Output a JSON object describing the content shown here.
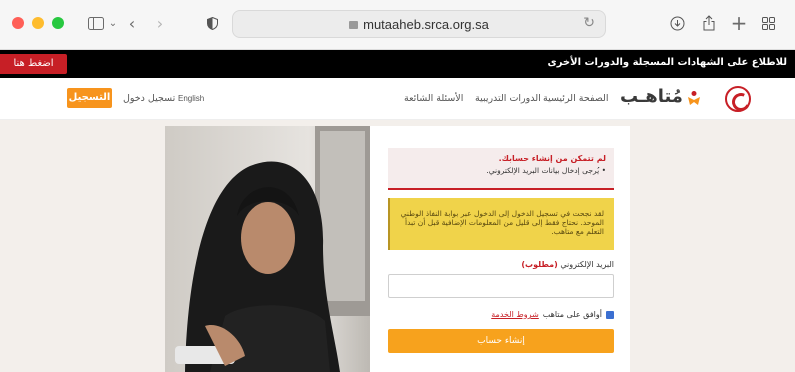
{
  "browser": {
    "url": "mutaaheb.srca.org.sa",
    "colors": {
      "close": "#ff5f57",
      "minimize": "#febc2e",
      "maximize": "#28c840"
    },
    "icons": [
      "sidebar-icon",
      "chevron-down-icon",
      "back-icon",
      "forward-icon",
      "shield-icon",
      "lock-icon",
      "reload-icon",
      "download-icon",
      "share-icon",
      "new-tab-icon",
      "tab-overview-icon"
    ]
  },
  "banner": {
    "button_label": "اضغط هنا",
    "text": "للاطلاع على الشهادات المسجلة والدورات الأخرى"
  },
  "nav": {
    "register_label": "التسجيل",
    "login_label": "تسجيل دخول",
    "language_label": "English",
    "links": [
      "الأسئلة الشائعة",
      "الدورات التدريبية",
      "الصفحة الرئيسية"
    ],
    "logo_text": "مُتاهـب"
  },
  "form": {
    "error_title": "لم تتمكن من إنشاء حسابك.",
    "error_item": "يُرجى إدخال بيانات البريد الإلكتروني.",
    "info_text": "لقد نجحت في تسجيل الدخول إلى الدخول عبر بوابة النفاذ الوطني الموحد. نحتاج فقط إلى قليل من المعلومات الإضافية قبل أن تبدأ التعلم مع متاهب.",
    "email_label": "البريد الإلكتروني",
    "required_label": "(مطلوب)",
    "email_value": "",
    "terms_prefix": "أوافق على متاهب",
    "terms_link": "شروط الخدمة",
    "terms_checked": true,
    "submit_label": "إنشاء حساب"
  },
  "theme": {
    "accent": "#f7941d",
    "danger": "#c71f26",
    "info_bg": "#f0d34a"
  }
}
